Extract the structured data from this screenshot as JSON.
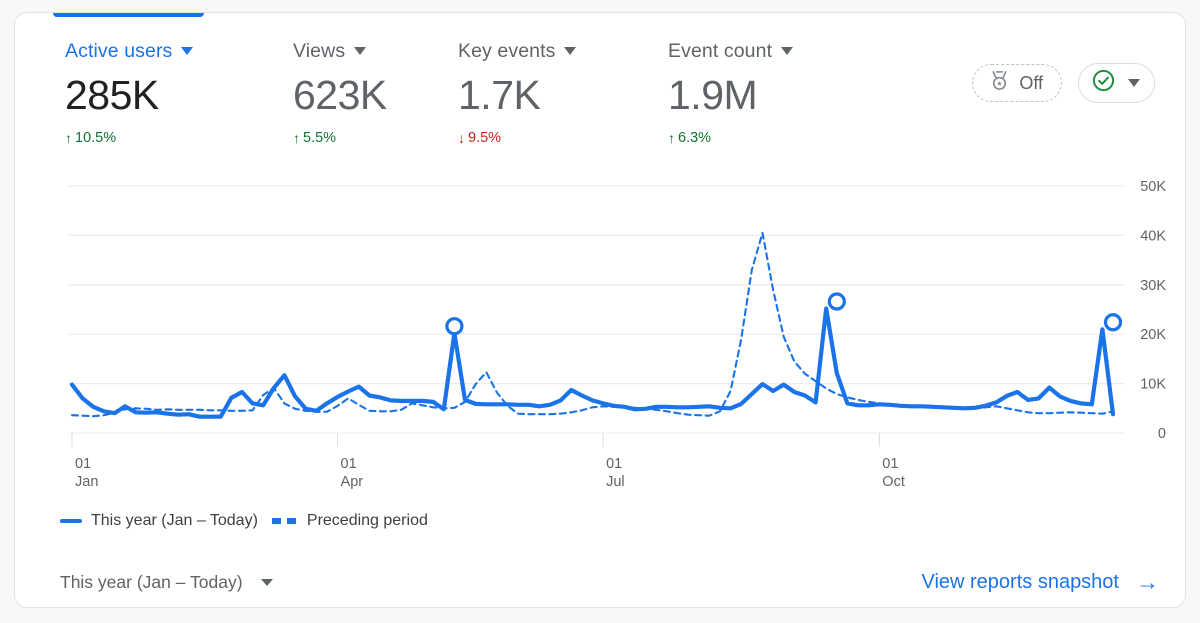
{
  "card": {
    "tab_indicator_color": "#1a73e8"
  },
  "metrics": [
    {
      "name": "Active users",
      "value": "285K",
      "delta": "10.5%",
      "delta_direction": "up",
      "delta_arrow": "↑",
      "selected": true
    },
    {
      "name": "Views",
      "value": "623K",
      "delta": "5.5%",
      "delta_direction": "up",
      "delta_arrow": "↑",
      "selected": false
    },
    {
      "name": "Key events",
      "value": "1.7K",
      "delta": "9.5%",
      "delta_direction": "down",
      "delta_arrow": "↓",
      "selected": false
    },
    {
      "name": "Event count",
      "value": "1.9M",
      "delta": "6.3%",
      "delta_direction": "up",
      "delta_arrow": "↑",
      "selected": false
    }
  ],
  "top_controls": {
    "comparison_chip": {
      "icon": "medal-icon",
      "label": "Off"
    },
    "status_chip": {
      "icon": "check-circle-icon",
      "icon_color": "#1e8e3e"
    }
  },
  "legend": [
    {
      "label": "This year (Jan – Today)",
      "style": "solid",
      "color": "#1a73e8"
    },
    {
      "label": "Preceding period",
      "style": "dashed",
      "color": "#1a73e8"
    }
  ],
  "footer": {
    "date_range": "This year (Jan – Today)",
    "snapshot_link": "View reports snapshot",
    "snapshot_arrow": "→"
  },
  "chart_data": {
    "type": "line",
    "title": "",
    "xlabel": "",
    "ylabel": "",
    "ylim": [
      0,
      50000
    ],
    "grid": true,
    "legend_position": "bottom-left",
    "y_ticks": [
      0,
      10000,
      20000,
      30000,
      40000,
      50000
    ],
    "y_tick_labels": [
      "0",
      "10K",
      "20K",
      "30K",
      "40K",
      "50K"
    ],
    "x_ticks": [
      0,
      25,
      50,
      76
    ],
    "x_tick_labels": [
      {
        "day": "01",
        "month": "Jan"
      },
      {
        "day": "01",
        "month": "Apr"
      },
      {
        "day": "01",
        "month": "Jul"
      },
      {
        "day": "01",
        "month": "Oct"
      }
    ],
    "markers": [
      {
        "x": 36,
        "y": 20200
      },
      {
        "x": 72,
        "y": 25200
      },
      {
        "x": 98,
        "y": 21000
      }
    ],
    "series": [
      {
        "name": "This year (Jan – Today)",
        "style": "solid",
        "color": "#1a73e8",
        "values": [
          9800,
          7000,
          5300,
          4400,
          4000,
          5400,
          4200,
          4100,
          4200,
          3900,
          3700,
          3800,
          3300,
          3300,
          3300,
          7100,
          8300,
          6000,
          5600,
          9100,
          11700,
          7400,
          4900,
          4500,
          6000,
          7300,
          8400,
          9400,
          7600,
          7200,
          6600,
          6500,
          6500,
          6500,
          6300,
          4800,
          20200,
          6700,
          5900,
          5800,
          5800,
          5800,
          5700,
          5700,
          5400,
          5700,
          6600,
          8700,
          7600,
          6600,
          6000,
          5500,
          5300,
          4800,
          4900,
          5300,
          5300,
          5200,
          5200,
          5300,
          5400,
          5100,
          5000,
          5900,
          7900,
          9900,
          8500,
          9800,
          8300,
          7600,
          6200,
          25200,
          12100,
          6000,
          5600,
          5600,
          5800,
          5700,
          5500,
          5400,
          5400,
          5300,
          5200,
          5100,
          5000,
          5100,
          5500,
          6200,
          7500,
          8300,
          6700,
          7000,
          9200,
          7400,
          6500,
          6000,
          5800,
          21000,
          3800
        ]
      },
      {
        "name": "Preceding period",
        "style": "dashed",
        "color": "#1a73e8",
        "values": [
          3600,
          3500,
          3400,
          3600,
          4100,
          4800,
          5000,
          4900,
          4700,
          4800,
          4700,
          4700,
          4700,
          4600,
          4600,
          4500,
          4500,
          4600,
          7700,
          9100,
          6000,
          4900,
          4500,
          4300,
          4300,
          5500,
          7000,
          5700,
          4500,
          4400,
          4400,
          4700,
          6000,
          5600,
          5200,
          5000,
          5100,
          6300,
          9900,
          12300,
          8200,
          5500,
          3900,
          3800,
          3800,
          3800,
          3900,
          4200,
          4600,
          5200,
          5400,
          5300,
          5200,
          5100,
          4900,
          4700,
          4400,
          4000,
          3700,
          3600,
          3500,
          4400,
          8500,
          19000,
          33000,
          40500,
          29000,
          19500,
          14500,
          12000,
          10500,
          9000,
          7900,
          7200,
          6700,
          6300,
          6000,
          5800,
          5600,
          5500,
          5400,
          5200,
          5100,
          5000,
          4900,
          5000,
          5200,
          5400,
          5000,
          4600,
          4200,
          4000,
          4000,
          4100,
          4200,
          4100,
          4000,
          3900,
          4400
        ]
      }
    ]
  }
}
